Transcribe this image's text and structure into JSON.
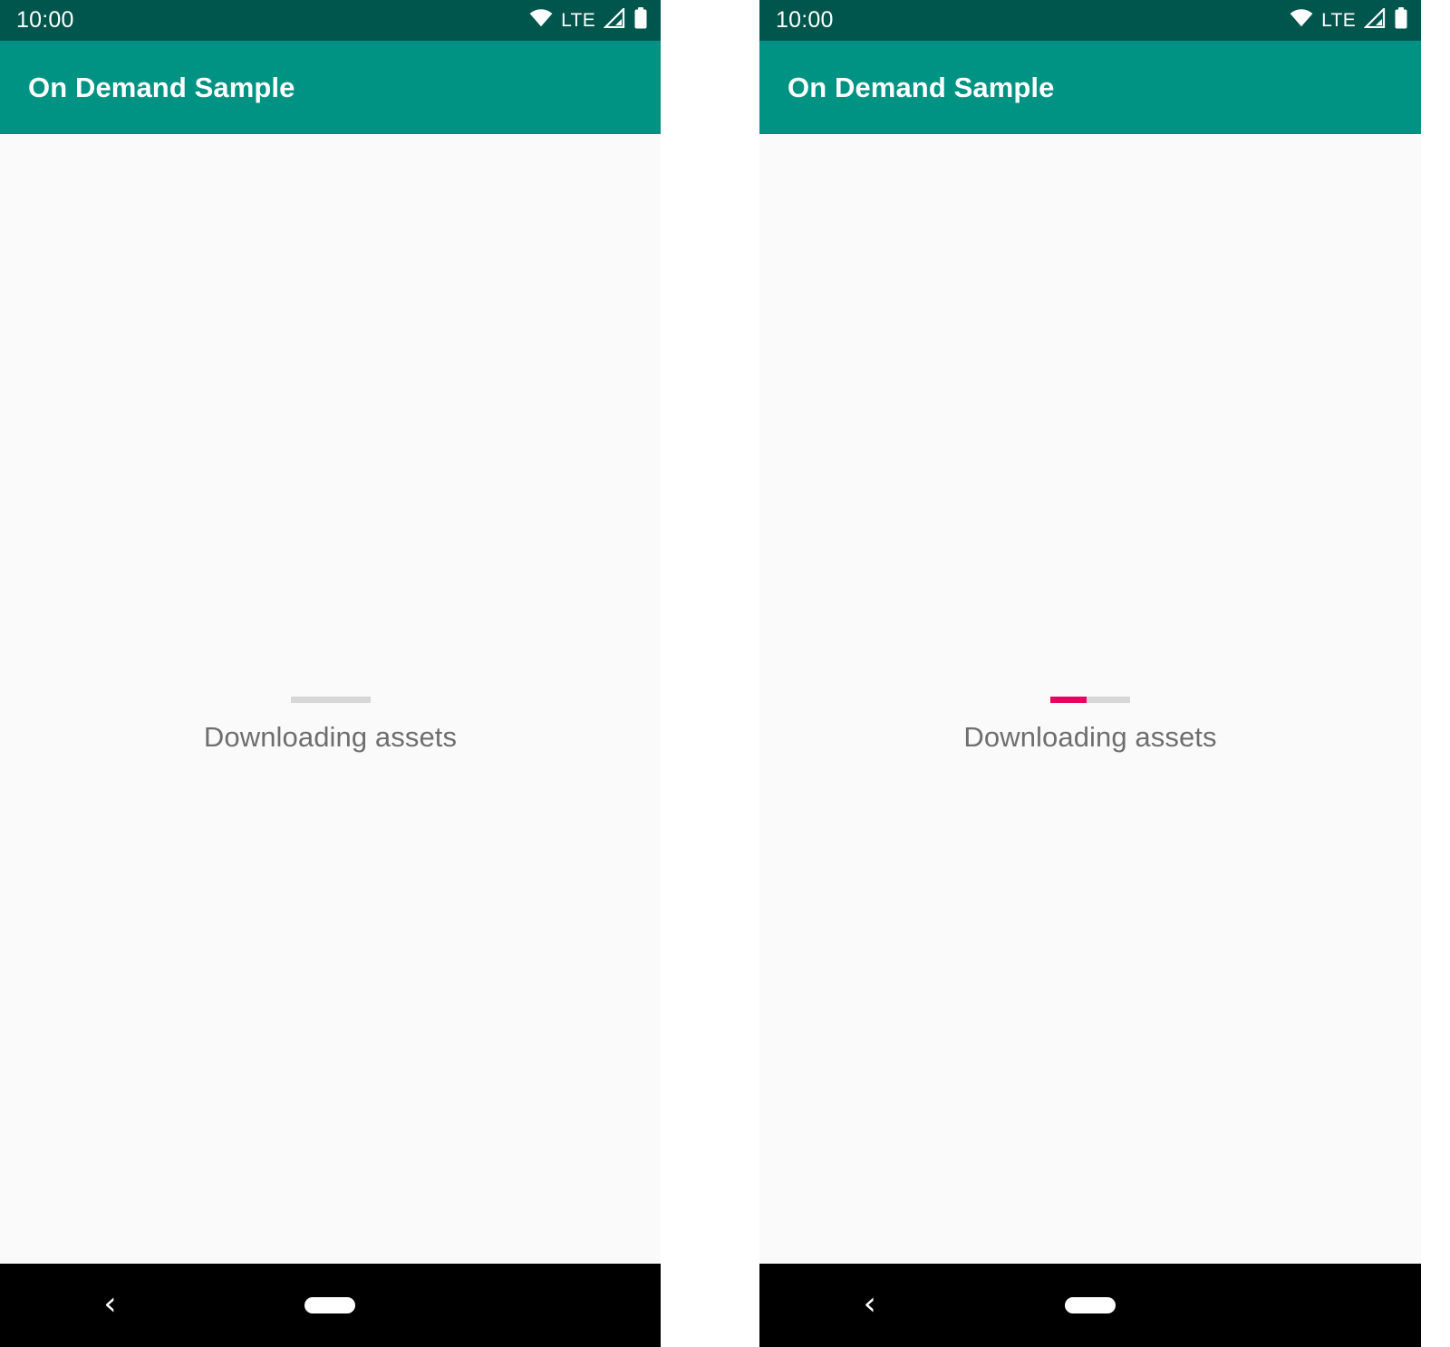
{
  "screens": [
    {
      "id": "screen-left",
      "status_bar": {
        "clock": "10:00",
        "network_label": "LTE",
        "icons": [
          "wifi-icon",
          "signal-icon",
          "battery-icon"
        ]
      },
      "app_bar": {
        "title": "On Demand Sample"
      },
      "content": {
        "progress": {
          "percent": 0,
          "track_color": "#D7D7D7",
          "fill_color": "#EC005F"
        },
        "status_label": "Downloading assets"
      },
      "nav_bar": {
        "back_glyph": "‹",
        "back_label": "back-button",
        "home_label": "home-pill"
      }
    },
    {
      "id": "screen-right",
      "status_bar": {
        "clock": "10:00",
        "network_label": "LTE",
        "icons": [
          "wifi-icon",
          "signal-icon",
          "battery-icon"
        ]
      },
      "app_bar": {
        "title": "On Demand Sample"
      },
      "content": {
        "progress": {
          "percent": 45,
          "track_color": "#D7D7D7",
          "fill_color": "#EC005F"
        },
        "status_label": "Downloading assets"
      },
      "nav_bar": {
        "back_glyph": "‹",
        "back_label": "back-button",
        "home_label": "home-pill"
      }
    }
  ],
  "theme": {
    "status_bar_color": "#00564C",
    "app_bar_color": "#009383",
    "content_background": "#FAFAFA",
    "nav_bar_color": "#000000",
    "accent_color": "#EC005F",
    "label_color": "#6E6E6E"
  }
}
